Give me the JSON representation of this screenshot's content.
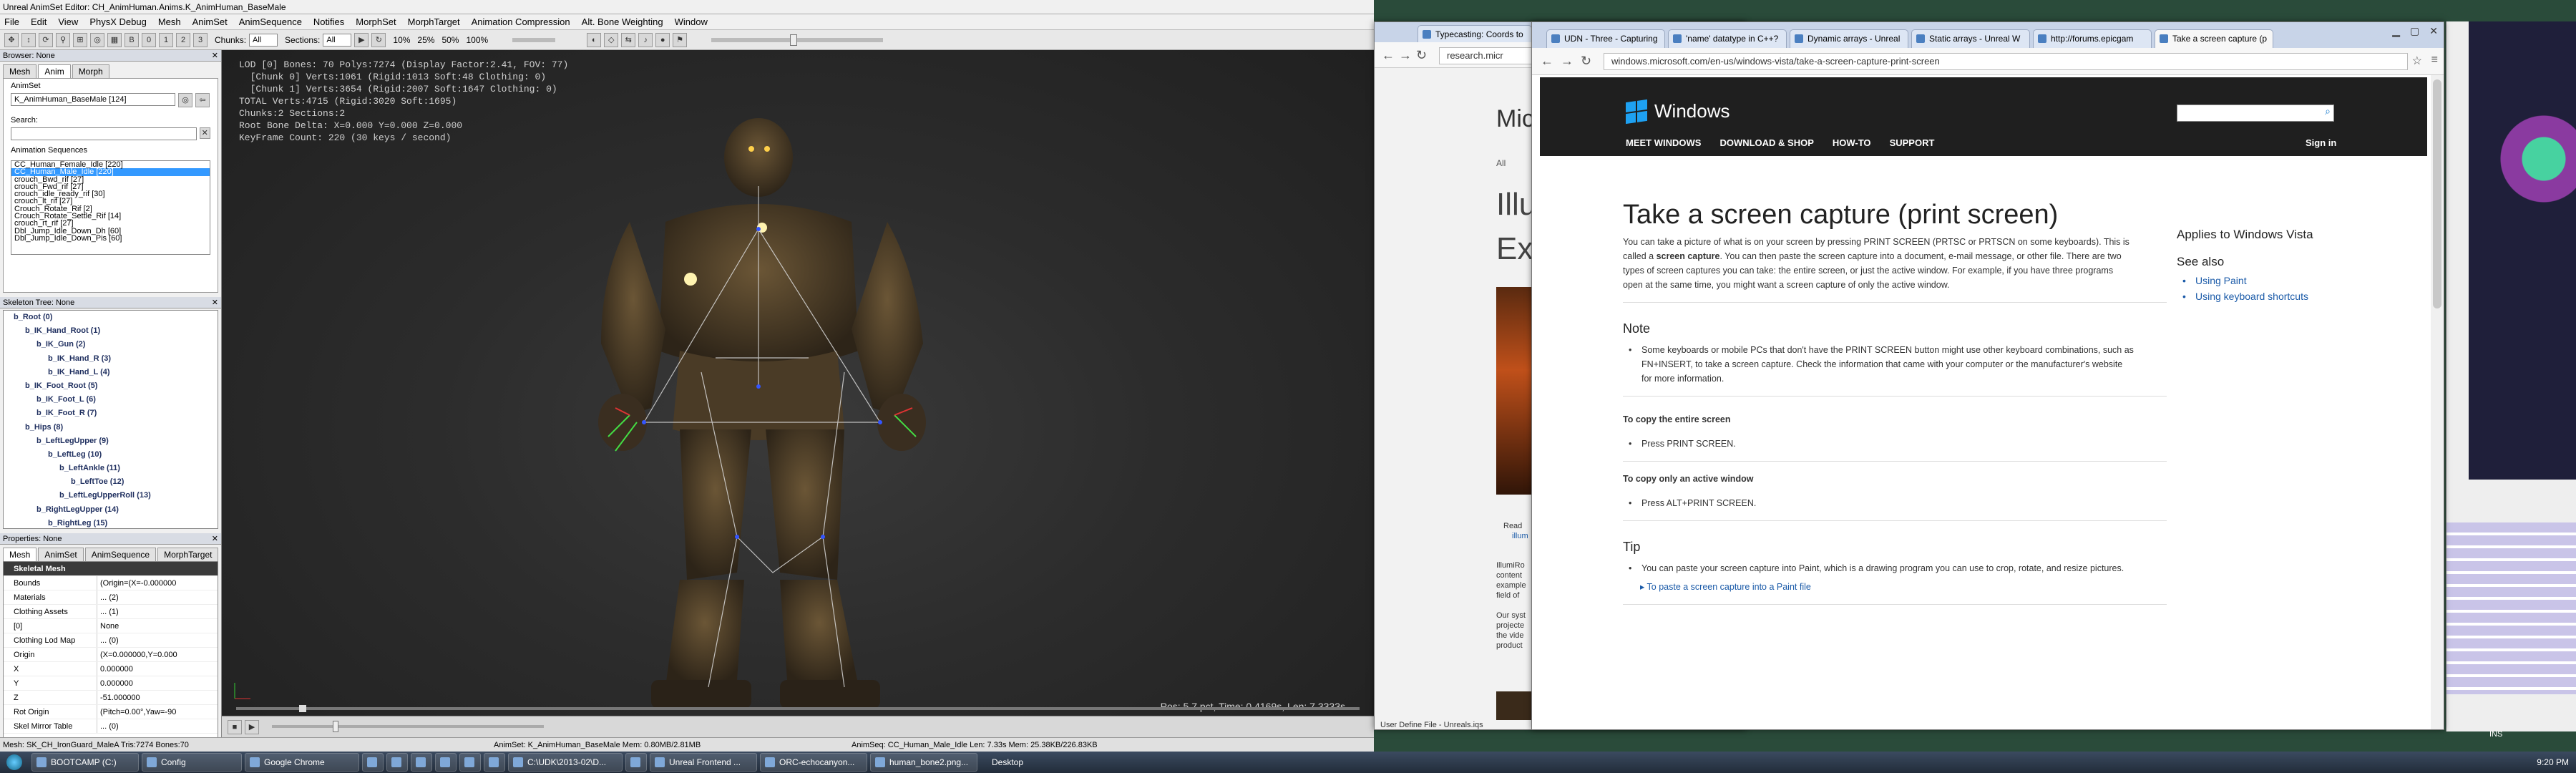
{
  "ue": {
    "title": "Unreal AnimSet Editor: CH_AnimHuman.Anims.K_AnimHuman_BaseMale",
    "menu": [
      "File",
      "Edit",
      "View",
      "PhysX Debug",
      "Mesh",
      "AnimSet",
      "AnimSequence",
      "Notifies",
      "MorphSet",
      "MorphTarget",
      "Animation Compression",
      "Alt. Bone Weighting",
      "Window"
    ],
    "toolbar": {
      "chunks_label": "Chunks:",
      "chunks_value": "All",
      "sections_label": "Sections:",
      "sections_value": "All",
      "pct_labels": [
        "10%",
        "25%",
        "50%",
        "100%"
      ]
    },
    "browser": {
      "title": "Browser: None",
      "tabs": [
        "Mesh",
        "Anim",
        "Morph"
      ],
      "animset_label": "AnimSet",
      "animset_value": "K_AnimHuman_BaseMale [124]",
      "search_label": "Search:",
      "seq_label": "Animation Sequences",
      "sequences": [
        "CC_Human_Female_Idle [220]",
        "CC_Human_Male_Idle [220]",
        "crouch_Bwd_rif [27]",
        "crouch_Fwd_rif [27]",
        "crouch_idle_ready_rif [30]",
        "crouch_lt_rif [27]",
        "Crouch_Rotate_Rif [2]",
        "Crouch_Rotate_Settle_Rif [14]",
        "crouch_rt_rif [27]",
        "Dbl_Jump_Idle_Down_Dh [60]",
        "Dbl_Jump_Idle_Down_Pis [60]"
      ],
      "selected_index": 1
    },
    "skeleton": {
      "title": "Skeleton Tree: None",
      "bones": [
        "b_Root (0)",
        "b_IK_Hand_Root (1)",
        "b_IK_Gun (2)",
        "b_IK_Hand_R (3)",
        "b_IK_Hand_L (4)",
        "b_IK_Foot_Root (5)",
        "b_IK_Foot_L (6)",
        "b_IK_Foot_R (7)",
        "b_Hips (8)",
        "b_LeftLegUpper (9)",
        "b_LeftLeg (10)",
        "b_LeftAnkle (11)",
        "b_LeftToe (12)",
        "b_LeftLegUpperRoll (13)",
        "b_RightLegUpper (14)",
        "b_RightLeg (15)"
      ]
    },
    "properties": {
      "title": "Properties: None",
      "tabs": [
        "Mesh",
        "AnimSet",
        "AnimSequence",
        "MorphTarget"
      ],
      "rows": [
        {
          "k": "Skeletal Mesh",
          "v": "",
          "head": true
        },
        {
          "k": "Bounds",
          "v": "(Origin=(X=-0.000000"
        },
        {
          "k": "Materials",
          "v": "... (2)"
        },
        {
          "k": "Clothing Assets",
          "v": "... (1)"
        },
        {
          "k": "[0]",
          "v": "None"
        },
        {
          "k": "Clothing Lod Map",
          "v": "... (0)"
        },
        {
          "k": "Origin",
          "v": "(X=0.000000,Y=0.000"
        },
        {
          "k": "X",
          "v": "0.000000"
        },
        {
          "k": "Y",
          "v": "0.000000"
        },
        {
          "k": "Z",
          "v": "-51.000000"
        },
        {
          "k": "Rot Origin",
          "v": "(Pitch=0.00°,Yaw=-90"
        },
        {
          "k": "Skel Mirror Table",
          "v": "... (0)"
        }
      ]
    },
    "viewport": {
      "info": "LOD [0] Bones: 70 Polys:7274 (Display Factor:2.41, FOV: 77)\n  [Chunk 0] Verts:1061 (Rigid:1013 Soft:48 Clothing: 0)\n  [Chunk 1] Verts:3654 (Rigid:2007 Soft:1647 Clothing: 0)\nTOTAL Verts:4715 (Rigid:3020 Soft:1695)\nChunks:2 Sections:2\nRoot Bone Delta: X=0.000 Y=0.000 Z=0.000\nKeyFrame Count: 220 (30 keys / second)",
      "pos": "Pos: 5.7 pct, Time: 0.4169s, Len: 7.3333s"
    },
    "status": {
      "mesh": "Mesh: SK_CH_IronGuard_MaleA  Tris:7274  Bones:70",
      "animset": "AnimSet: K_AnimHuman_BaseMale  Mem: 0.80MB/2.81MB",
      "animseq": "AnimSeq: CC_Human_Male_Idle  Len: 7.33s  Mem: 25.38KB/226.83KB"
    },
    "colors": {
      "selection": "#3399ff",
      "viewport": "#2c2c2c"
    }
  },
  "browser": {
    "tabs": [
      "Typecasting: Coords to",
      "UDN - Three - Capturing",
      "'name' datatype in C++?",
      "Dynamic arrays - Unreal",
      "Static arrays - Unreal W",
      "http://forums.epicgam",
      "Take a screen capture (p"
    ],
    "active_tab": 6,
    "bg_url": "research.micr",
    "url": "windows.microsoft.com/en-us/windows-vista/take-a-screen-capture-print-screen",
    "bg_page": {
      "title1": "Mic",
      "title2": "Illu",
      "title3": "Exp",
      "all": "All",
      "read": "Read",
      "illu": "illum",
      "p1": "IllumiRo",
      "p2": "content",
      "p3": "example",
      "p4": "field of",
      "p5": "Our syst",
      "p6": "projecte",
      "p7": "the vide",
      "p8": "product",
      "footer": "User Define File - Unreals.iqs"
    }
  },
  "ms": {
    "brand": "Windows",
    "nav": [
      "MEET WINDOWS",
      "DOWNLOAD & SHOP",
      "HOW-TO",
      "SUPPORT"
    ],
    "signin": "Sign in",
    "title": "Take a screen capture (print screen)",
    "intro1": "You can take a picture of what is on your screen by pressing PRINT SCREEN (PRTSC or PRTSCN on some keyboards). This is",
    "intro2_pre": "called a ",
    "intro2_bold": "screen capture",
    "intro2_post": ". You can then paste the screen capture into a document, e-mail message, or other file. There are two",
    "intro3": "types of screen captures you can take: the entire screen, or just the active window. For example, if you have three programs",
    "intro4": "open at the same time, you might want a screen capture of only the active window.",
    "note_h": "Note",
    "note1": "Some keyboards or mobile PCs that don't have the PRINT SCREEN button might use other keyboard combinations, such as",
    "note2": "FN+INSERT, to take a screen capture. Check the information that came with your computer or the manufacturer's website",
    "note3": "for more information.",
    "copy_entire_h": "To copy the entire screen",
    "copy_entire": "Press PRINT SCREEN.",
    "copy_active_h": "To copy only an active window",
    "copy_active": "Press ALT+PRINT SCREEN.",
    "tip_h": "Tip",
    "tip": "You can paste your screen capture into Paint, which is a drawing program you can use to crop, rotate, and resize pictures.",
    "tip_link": "To paste a screen capture into a Paint file",
    "applies": "Applies to Windows Vista",
    "see_also": "See also",
    "links": [
      "Using Paint",
      "Using keyboard shortcuts"
    ]
  },
  "taskbar": {
    "items": [
      "BOOTCAMP (C:)",
      "Config",
      "Google Chrome",
      "",
      "",
      "",
      "",
      "",
      "",
      "C:\\UDK\\2013-02\\D...",
      "",
      "Unreal Frontend ...",
      "ORC-echocanyon...",
      "human_bone2.png..."
    ],
    "desktop": "Desktop",
    "clock": "9:20 PM",
    "ins": "INS"
  }
}
